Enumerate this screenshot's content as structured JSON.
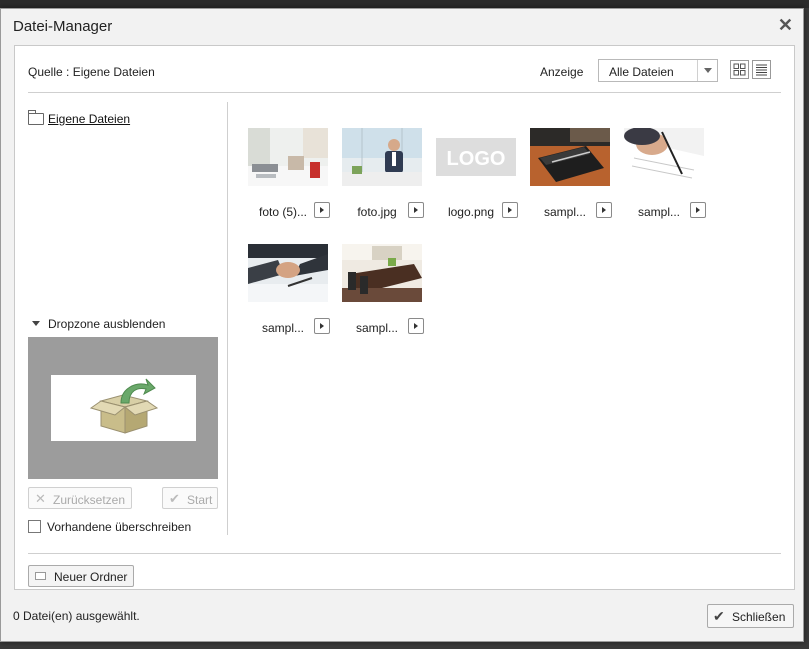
{
  "dialog": {
    "title": "Datei-Manager",
    "close_symbol": "✕"
  },
  "toolbar": {
    "source_label": "Quelle : Eigene Dateien",
    "view_label": "Anzeige",
    "view_select_value": "Alle Dateien",
    "view_modes": [
      "grid-icon",
      "list-icon"
    ]
  },
  "sidebar": {
    "folder_label": "Eigene Dateien",
    "dropzone_toggle_label": "Dropzone ausblenden",
    "reset_label": "Zurücksetzen",
    "start_label": "Start",
    "overwrite_label": "Vorhandene überschreiben",
    "overwrite_checked": false
  },
  "files": [
    {
      "name": "foto (5)...",
      "thumb": "office-desk-photo"
    },
    {
      "name": "foto.jpg",
      "thumb": "businessman-photo"
    },
    {
      "name": "logo.png",
      "thumb": "logo-placeholder",
      "thumb_text": "LOGO"
    },
    {
      "name": "sampl...",
      "thumb": "notebook-pen-photo"
    },
    {
      "name": "sampl...",
      "thumb": "signing-document-photo"
    },
    {
      "name": "sampl...",
      "thumb": "handshake-photo"
    },
    {
      "name": "sampl...",
      "thumb": "meeting-room-photo"
    }
  ],
  "footer": {
    "new_folder_label": "Neuer Ordner",
    "status": "0 Datei(en) ausgewählt.",
    "close_label": "Schließen"
  },
  "colors": {
    "dialog_bg": "#f2f2f2",
    "dropzone_bg": "#9c9c9c",
    "accent_green": "#6aa86a"
  }
}
